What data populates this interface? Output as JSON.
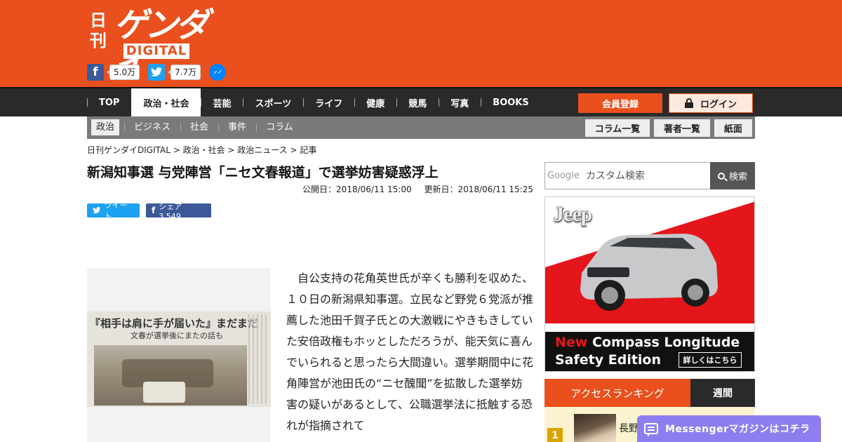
{
  "logo": {
    "kanji": "日刊",
    "katakana": "ゲンダイ",
    "digital": "DIGITAL"
  },
  "social": {
    "facebook_count": "5.0万",
    "twitter_count": "7.7万"
  },
  "nav": {
    "items": [
      "TOP",
      "政治・社会",
      "芸能",
      "スポーツ",
      "ライフ",
      "健康",
      "競馬",
      "写真",
      "BOOKS"
    ],
    "active": "政治・社会",
    "register": "会員登録",
    "login": "ログイン"
  },
  "subnav": {
    "items": [
      "政治",
      "ビジネス",
      "社会",
      "事件",
      "コラム"
    ],
    "active": "政治",
    "buttons": [
      "コラム一覧",
      "著者一覧",
      "紙面"
    ]
  },
  "breadcrumb": "日刊ゲンダイDIGITAL > 政治・社会 > 政治ニュース > 記事",
  "article": {
    "title": "新潟知事選 与党陣営「ニセ文春報道」で選挙妨害疑惑浮上",
    "published": "公開日：2018/06/11 15:00",
    "updated": "更新日：2018/06/11 15:25",
    "tweet_label": "ツイート",
    "share_label": "シェア 3,549",
    "image_headline": "『相手は肩に手が届いた』まだまだ",
    "image_subhead": "文春が選挙後にまたの話も",
    "body": "自公支持の花角英世氏が辛くも勝利を収めた、１０日の新潟県知事選。立民など野党６党派が推薦した池田千賀子氏との大激戦にやきもきしていた安倍政権もホッとしただろうが、能天気に喜んでいられると思ったら大間違い。選挙期間中に花角陣営が池田氏の“ニセ醜聞”を拡散した選挙妨害の疑いがあるとして、公職選挙法に抵触する恐れが指摘されて"
  },
  "sidebar": {
    "search_placeholder": "カスタム検索",
    "search_brand": "Google",
    "search_button": "検索",
    "ad": {
      "brand": "Jeep",
      "line1_highlight": "New",
      "line1_rest": " Compass Longitude",
      "line2": "Safety Edition",
      "more": "詳しくはこちら"
    },
    "ranking": {
      "title": "アクセスランキング",
      "tab": "週間",
      "first_rank": "1",
      "first_text": "長野"
    }
  },
  "messenger": {
    "label": "Messengerマガジンはコチラ"
  },
  "colors": {
    "brand_orange": "#e9501d",
    "nav_dark": "#2a2a2a",
    "messenger_purple": "#8b7fef"
  }
}
